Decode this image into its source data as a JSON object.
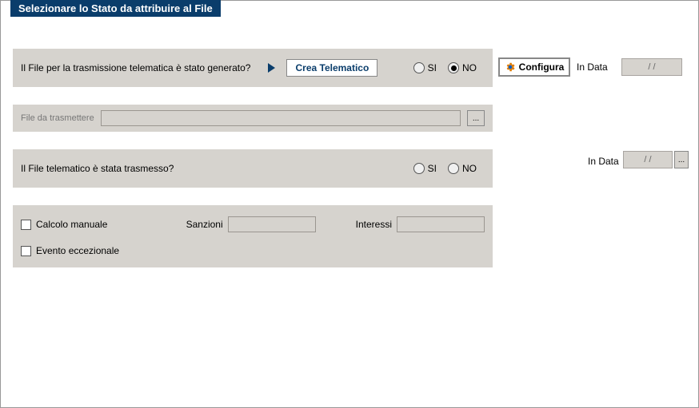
{
  "title": "Selezionare lo Stato da attribuire al File",
  "row1": {
    "question": "Il File per la trasmissione telematica è stato generato?",
    "crea_btn": "Crea Telematico",
    "si": "SI",
    "no": "NO",
    "selected": "NO"
  },
  "config_btn": "Configura",
  "indata_label": "In Data",
  "date1": "/  /",
  "row2": {
    "label": "File da trasmettere",
    "value": "",
    "dots": "..."
  },
  "row3": {
    "question": "Il File telematico è stata trasmesso?",
    "si": "SI",
    "no": "NO"
  },
  "date2": "/  /",
  "dots2": "...",
  "row4": {
    "calcolo": "Calcolo manuale",
    "sanzioni_lbl": "Sanzioni",
    "sanzioni_val": "",
    "interessi_lbl": "Interessi",
    "interessi_val": "",
    "evento": "Evento eccezionale"
  }
}
